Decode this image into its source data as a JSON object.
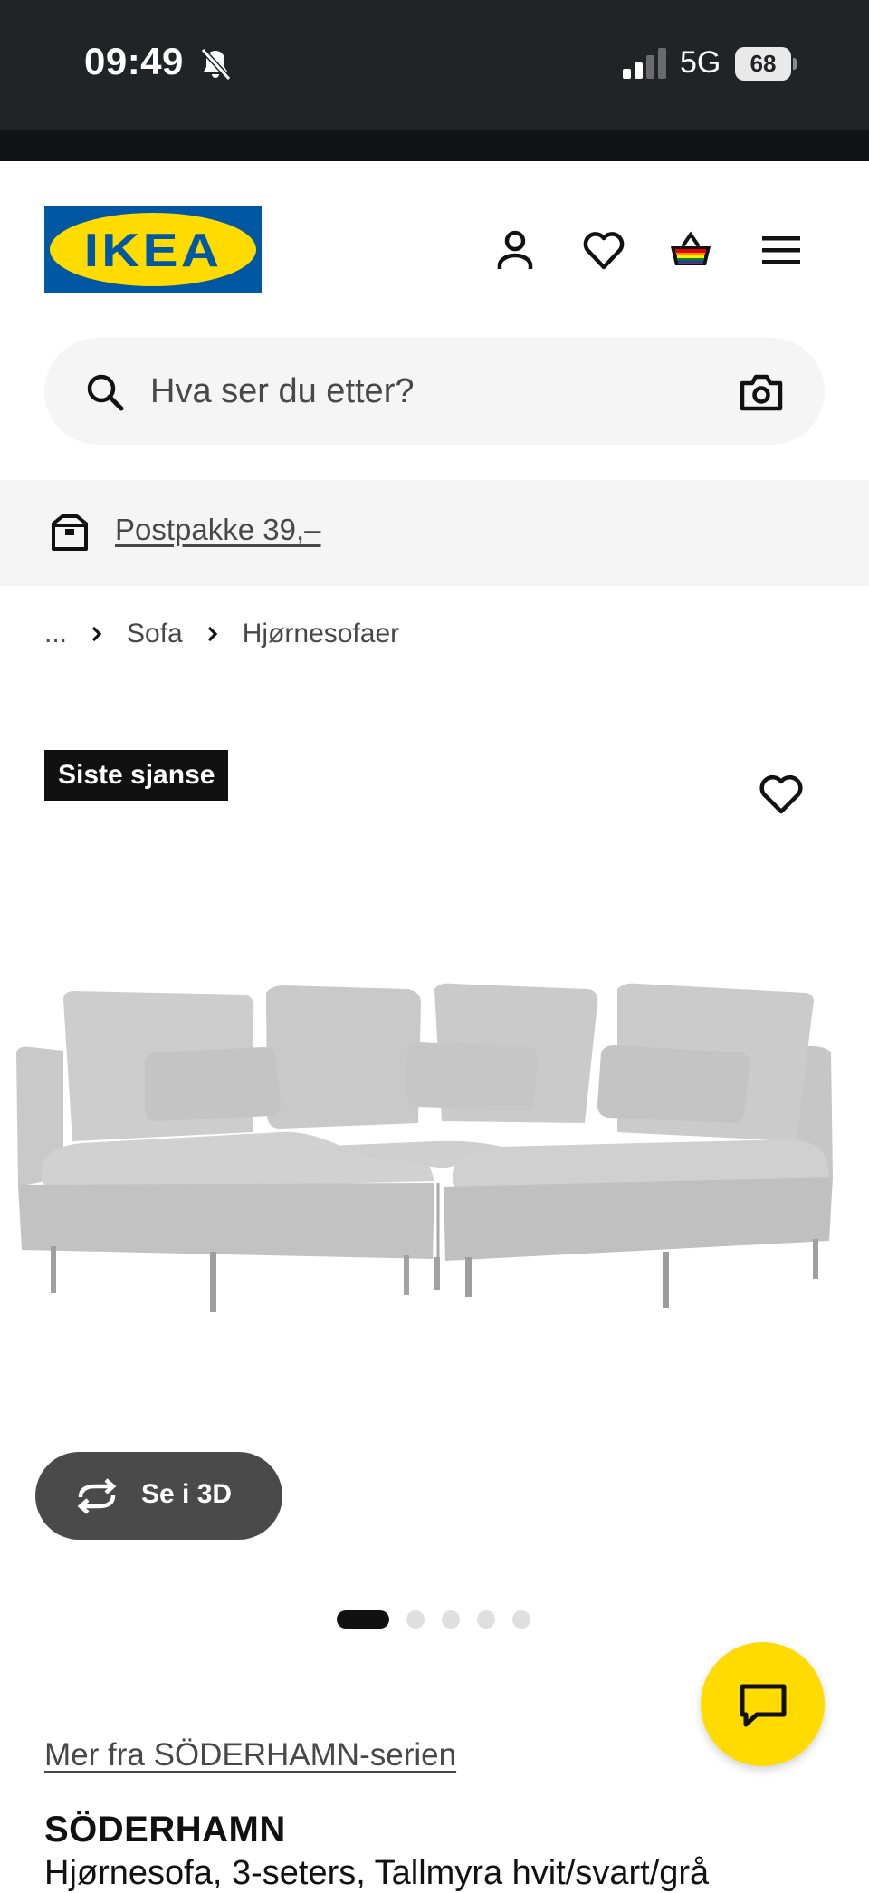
{
  "status_bar": {
    "time": "09:49",
    "network": "5G",
    "battery": "68",
    "icons": [
      "bell-off-icon",
      "signal-icon",
      "battery-icon"
    ]
  },
  "header": {
    "logo": "IKEA",
    "icons": [
      "account-icon",
      "wishlist-icon",
      "cart-icon",
      "menu-icon"
    ],
    "brand_colors": {
      "blue": "#0058a3",
      "yellow": "#ffdb00"
    }
  },
  "search": {
    "placeholder": "Hva ser du etter?",
    "icons": [
      "search-icon",
      "camera-icon"
    ]
  },
  "promo": {
    "label": "Postpakke 39,–",
    "icon": "parcel-icon"
  },
  "breadcrumb": {
    "items": [
      "...",
      "Sofa",
      "Hjørnesofaer"
    ]
  },
  "product": {
    "badge": "Siste sjanse",
    "view_3d_label": "Se i 3D",
    "image_count": 5,
    "active_image": 1,
    "series_link": "Mer fra SÖDERHAMN-serien",
    "name": "SÖDERHAMN",
    "description": "Hjørnesofa, 3-seters, Tallmyra hvit/svart/grå"
  },
  "chat": {
    "icon": "chat-icon"
  }
}
